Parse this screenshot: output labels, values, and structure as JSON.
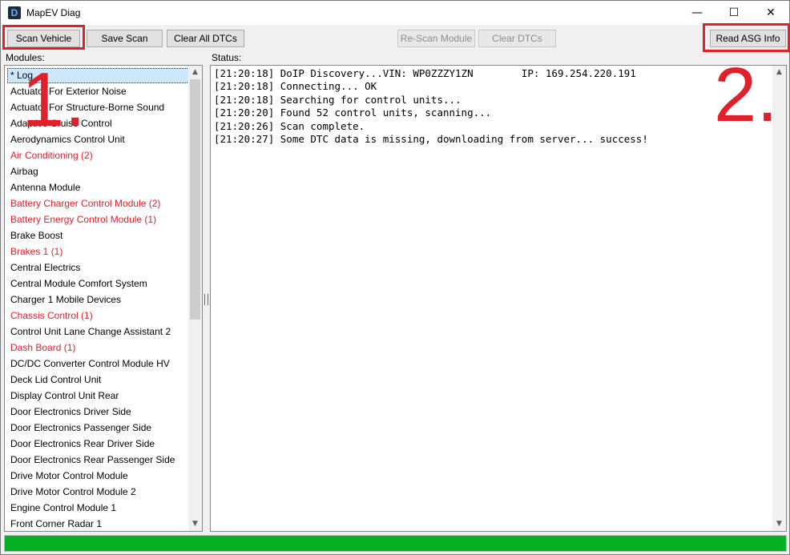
{
  "window": {
    "title": "MapEV Diag",
    "app_icon_letter": "D",
    "controls": {
      "minimize": "—",
      "maximize": "☐",
      "close": "✕"
    }
  },
  "toolbar": {
    "scan_vehicle": "Scan Vehicle",
    "save_scan": "Save Scan",
    "clear_all_dtcs": "Clear All DTCs",
    "rescan_module": "Re-Scan Module",
    "clear_dtcs": "Clear DTCs",
    "read_asg_info": "Read ASG Info"
  },
  "modules": {
    "label": "Modules:",
    "items": [
      {
        "label": "* Log",
        "warn": false,
        "selected": true
      },
      {
        "label": "Actuator For Exterior Noise",
        "warn": false
      },
      {
        "label": "Actuator For Structure-Borne Sound",
        "warn": false
      },
      {
        "label": "Adaptive Cruise Control",
        "warn": false
      },
      {
        "label": "Aerodynamics Control Unit",
        "warn": false
      },
      {
        "label": "Air Conditioning (2)",
        "warn": true
      },
      {
        "label": "Airbag",
        "warn": false
      },
      {
        "label": "Antenna Module",
        "warn": false
      },
      {
        "label": "Battery Charger Control Module (2)",
        "warn": true
      },
      {
        "label": "Battery Energy Control Module (1)",
        "warn": true
      },
      {
        "label": "Brake Boost",
        "warn": false
      },
      {
        "label": "Brakes 1 (1)",
        "warn": true
      },
      {
        "label": "Central Electrics",
        "warn": false
      },
      {
        "label": "Central Module Comfort System",
        "warn": false
      },
      {
        "label": "Charger 1 Mobile Devices",
        "warn": false
      },
      {
        "label": "Chassis Control (1)",
        "warn": true
      },
      {
        "label": "Control Unit Lane Change Assistant 2",
        "warn": false
      },
      {
        "label": "Dash Board (1)",
        "warn": true
      },
      {
        "label": "DC/DC Converter Control Module HV",
        "warn": false
      },
      {
        "label": "Deck Lid Control Unit",
        "warn": false
      },
      {
        "label": "Display Control Unit Rear",
        "warn": false
      },
      {
        "label": "Door Electronics Driver Side",
        "warn": false
      },
      {
        "label": "Door Electronics Passenger Side",
        "warn": false
      },
      {
        "label": "Door Electronics Rear Driver Side",
        "warn": false
      },
      {
        "label": "Door Electronics Rear Passenger Side",
        "warn": false
      },
      {
        "label": "Drive Motor Control Module",
        "warn": false
      },
      {
        "label": "Drive Motor Control Module 2",
        "warn": false
      },
      {
        "label": "Engine Control Module 1",
        "warn": false
      },
      {
        "label": "Front Corner Radar 1",
        "warn": false
      }
    ]
  },
  "status": {
    "label": "Status:",
    "lines": [
      "[21:20:18] DoIP Discovery...VIN: WP0ZZZY1ZN        IP: 169.254.220.191",
      "[21:20:18] Connecting... OK",
      "[21:20:18] Searching for control units...",
      "[21:20:20] Found 52 control units, scanning...",
      "[21:20:26] Scan complete.",
      "[21:20:27] Some DTC data is missing, downloading from server... success!"
    ]
  },
  "progress": {
    "value": 1.0
  },
  "annotations": {
    "one": "1.",
    "two": "2.",
    "color": "#e0202a"
  },
  "colors": {
    "warn_text": "#e0202a",
    "progress_fill": "#06b025",
    "selection": "#cce8ff"
  }
}
